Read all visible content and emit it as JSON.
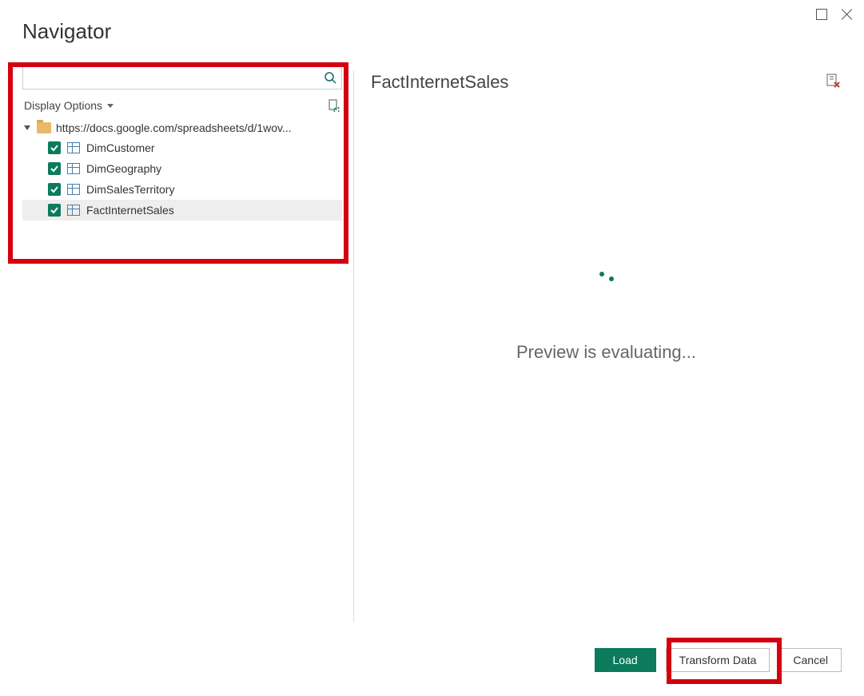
{
  "window": {
    "title": "Navigator"
  },
  "search": {
    "placeholder": "",
    "value": ""
  },
  "displayOptions": {
    "label": "Display Options"
  },
  "tree": {
    "rootLabel": "https://docs.google.com/spreadsheets/d/1wov...",
    "items": [
      {
        "label": "DimCustomer",
        "checked": true,
        "selected": false
      },
      {
        "label": "DimGeography",
        "checked": true,
        "selected": false
      },
      {
        "label": "DimSalesTerritory",
        "checked": true,
        "selected": false
      },
      {
        "label": "FactInternetSales",
        "checked": true,
        "selected": true
      }
    ]
  },
  "preview": {
    "title": "FactInternetSales",
    "message": "Preview is evaluating..."
  },
  "footer": {
    "load": "Load",
    "transform": "Transform Data",
    "cancel": "Cancel"
  }
}
